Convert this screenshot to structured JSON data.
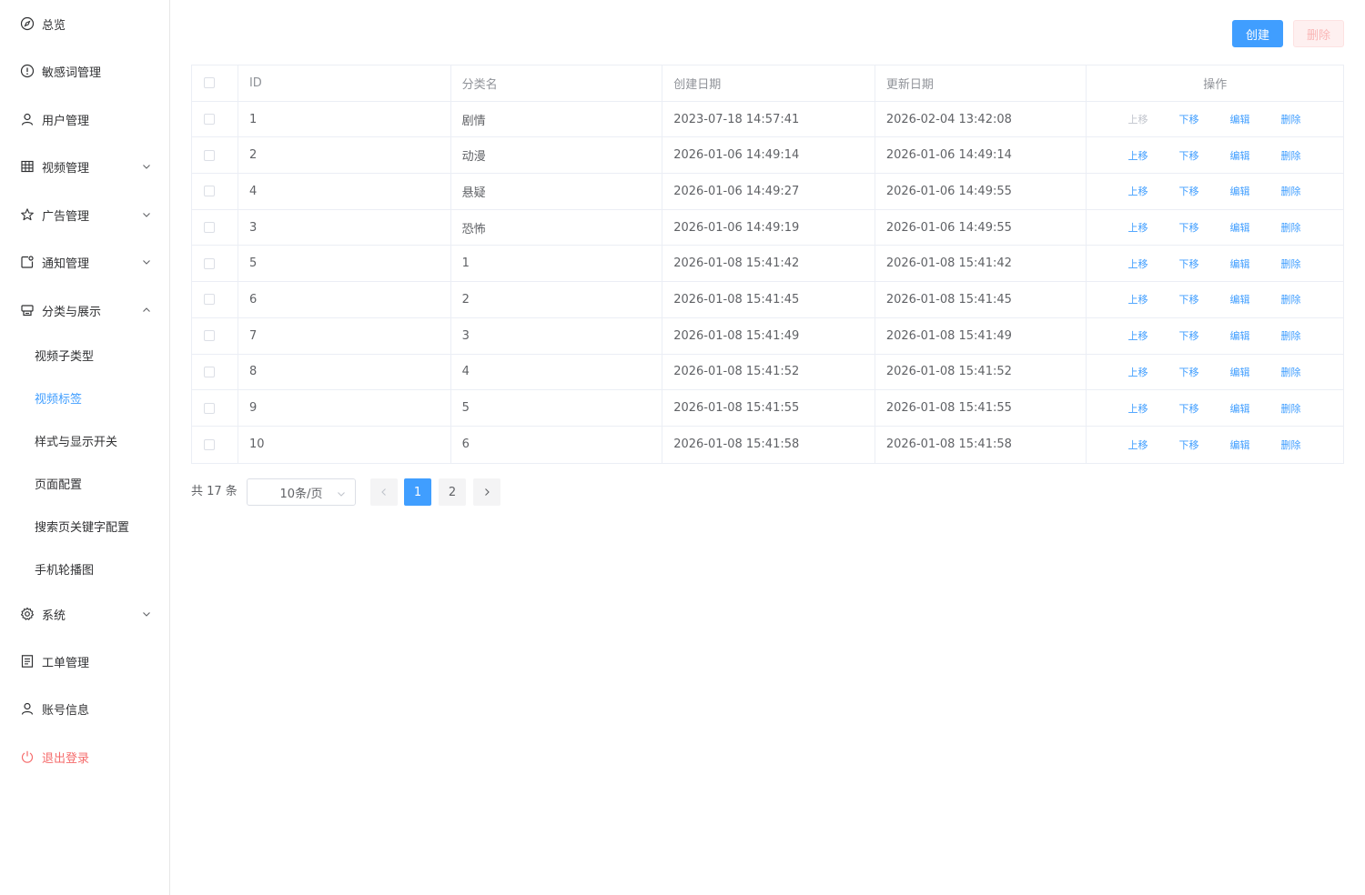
{
  "sidebar": {
    "items": [
      {
        "label": "总览",
        "icon": "compass-icon"
      },
      {
        "label": "敏感词管理",
        "icon": "warning-icon"
      },
      {
        "label": "用户管理",
        "icon": "user-icon"
      },
      {
        "label": "视频管理",
        "icon": "grid-icon"
      },
      {
        "label": "广告管理",
        "icon": "star-icon"
      },
      {
        "label": "通知管理",
        "icon": "notification-icon"
      },
      {
        "label": "分类与展示",
        "icon": "folder-icon"
      },
      {
        "label": "系统",
        "icon": "gear-icon"
      },
      {
        "label": "工单管理",
        "icon": "document-icon"
      },
      {
        "label": "账号信息",
        "icon": "account-icon"
      },
      {
        "label": "退出登录",
        "icon": "power-icon"
      }
    ],
    "sub_items": [
      {
        "label": "视频子类型"
      },
      {
        "label": "视频标签"
      },
      {
        "label": "样式与显示开关"
      },
      {
        "label": "页面配置"
      },
      {
        "label": "搜索页关键字配置"
      },
      {
        "label": "手机轮播图"
      }
    ],
    "active_sub": "视频标签"
  },
  "toolbar": {
    "create_label": "创建",
    "delete_label": "删除"
  },
  "table": {
    "headers": {
      "id": "ID",
      "name": "分类名",
      "created": "创建日期",
      "updated": "更新日期",
      "ops": "操作"
    },
    "ops_labels": {
      "up": "上移",
      "down": "下移",
      "edit": "编辑",
      "delete": "删除"
    },
    "rows": [
      {
        "id": "1",
        "name": "剧情",
        "created": "2023-07-18 14:57:41",
        "updated": "2026-02-04 13:42:08"
      },
      {
        "id": "2",
        "name": "动漫",
        "created": "2026-01-06 14:49:14",
        "updated": "2026-01-06 14:49:14"
      },
      {
        "id": "4",
        "name": "悬疑",
        "created": "2026-01-06 14:49:27",
        "updated": "2026-01-06 14:49:55"
      },
      {
        "id": "3",
        "name": "恐怖",
        "created": "2026-01-06 14:49:19",
        "updated": "2026-01-06 14:49:55"
      },
      {
        "id": "5",
        "name": "1",
        "created": "2026-01-08 15:41:42",
        "updated": "2026-01-08 15:41:42"
      },
      {
        "id": "6",
        "name": "2",
        "created": "2026-01-08 15:41:45",
        "updated": "2026-01-08 15:41:45"
      },
      {
        "id": "7",
        "name": "3",
        "created": "2026-01-08 15:41:49",
        "updated": "2026-01-08 15:41:49"
      },
      {
        "id": "8",
        "name": "4",
        "created": "2026-01-08 15:41:52",
        "updated": "2026-01-08 15:41:52"
      },
      {
        "id": "9",
        "name": "5",
        "created": "2026-01-08 15:41:55",
        "updated": "2026-01-08 15:41:55"
      },
      {
        "id": "10",
        "name": "6",
        "created": "2026-01-08 15:41:58",
        "updated": "2026-01-08 15:41:58"
      }
    ]
  },
  "pagination": {
    "total_text": "共 17 条",
    "page_size_label": "10条/页",
    "pages": [
      "1",
      "2"
    ],
    "current_page": "1"
  },
  "colors": {
    "primary": "#409eff",
    "danger": "#f56c6c",
    "border": "#ebeef5"
  }
}
